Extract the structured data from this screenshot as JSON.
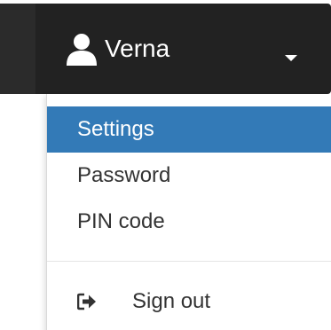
{
  "user_menu": {
    "username": "Verna",
    "user_icon": "user-icon",
    "caret_icon": "caret-down-icon"
  },
  "dropdown": {
    "items": [
      {
        "label": "Settings",
        "active": true
      },
      {
        "label": "Password",
        "active": false
      },
      {
        "label": "PIN code",
        "active": false
      }
    ],
    "sign_out": {
      "label": "Sign out",
      "icon": "sign-out-icon"
    }
  },
  "colors": {
    "header_background": "#222222",
    "active_item_background": "#337ab7",
    "active_item_text": "#ffffff",
    "item_text": "#333333"
  }
}
